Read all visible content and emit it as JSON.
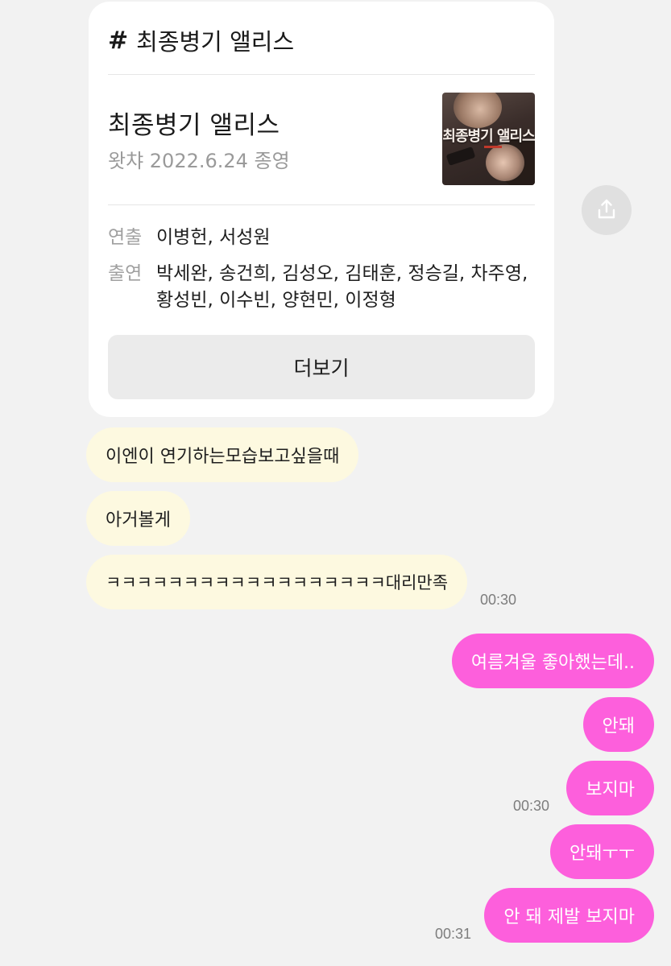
{
  "card": {
    "hashtag_symbol": "#",
    "hashtag_text": "최종병기 앨리스",
    "title": "최종병기 앨리스",
    "subtitle": "왓챠 2022.6.24 종영",
    "poster_title": "최종병기 앨리스",
    "director_label": "연출",
    "director_value": "이병헌, 서성원",
    "cast_label": "출연",
    "cast_value": "박세완, 송건희, 김성오, 김태훈, 정승길, 차주영, 황성빈, 이수빈, 양현민, 이정형",
    "more_button": "더보기"
  },
  "messages": {
    "m1": "이엔이 연기하는모습보고싶을때",
    "m2": "아거볼게",
    "m3": "ㅋㅋㅋㅋㅋㅋㅋㅋㅋㅋㅋㅋㅋㅋㅋㅋㅋㅋ대리만족",
    "t1": "00:30",
    "m4": "여름겨울 좋아했는데..",
    "m5": "안돼",
    "m6": "보지마",
    "t2": "00:30",
    "m7": "안돼ㅜㅜ",
    "m8": "안 돼 제발 보지마",
    "t3": "00:31"
  },
  "colors": {
    "background": "#f2f2f2",
    "incoming_bubble": "#fdf9e0",
    "outgoing_bubble": "#fd5fdc",
    "card": "#ffffff"
  },
  "icons": {
    "share": "share-icon"
  }
}
